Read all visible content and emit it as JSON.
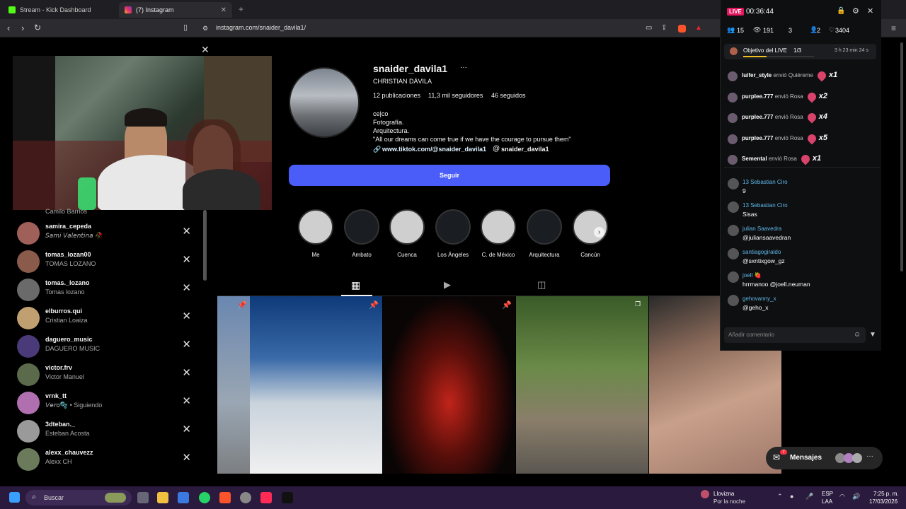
{
  "browser": {
    "tabs": [
      {
        "label": "Stream - Kick Dashboard"
      },
      {
        "label": "(7) Instagram"
      }
    ],
    "url": "instagram.com/snaider_davila1/"
  },
  "profile": {
    "username": "snaider_davila1",
    "more": "···",
    "full_name": "CHRISTIAN DÁVILA",
    "posts": "12 publicaciones",
    "followers": "11,3 mil seguidores",
    "following": "46 seguidos",
    "bio": [
      "ce|co",
      "Fotografía.",
      "Arquitectura.",
      "\"All our dreams can come true if we have the courage to pursue them\""
    ],
    "link": "www.tiktok.com/@snaider_davila1",
    "threads": "snaider_davila1",
    "follow_label": "Seguir"
  },
  "highlights": [
    {
      "label": "Me",
      "color": "#cfcfcf"
    },
    {
      "label": "Ambato",
      "color": "#1a1d22"
    },
    {
      "label": "Cuenca",
      "color": "#cfcfcf"
    },
    {
      "label": "Los Ángeles",
      "color": "#1a1d22"
    },
    {
      "label": "C. de México",
      "color": "#cfcfcf"
    },
    {
      "label": "Arquitectura",
      "color": "#1a1d22"
    },
    {
      "label": "Cancún",
      "color": "#cfcfcf"
    }
  ],
  "sidebar": {
    "top_partial": "Camilo Barrios",
    "items": [
      {
        "username": "samira_cepeda",
        "name": "𝘚𝘢𝘮𝘪 𝘝𝘢𝘭𝘦𝘯𝘵𝘪𝘯𝘢 🥀",
        "color": "#a0605a"
      },
      {
        "username": "tomas_lozan00",
        "name": "TOMAS LOZANO",
        "color": "#8a5a4a"
      },
      {
        "username": "tomas._lozano",
        "name": "Tomas lozano",
        "color": "#6a6a6a"
      },
      {
        "username": "elburros.qui",
        "name": "Cristian Loaiza",
        "color": "#c0a070"
      },
      {
        "username": "daguero_music",
        "name": "DAGUERO MUSIC",
        "color": "#4a3a7a"
      },
      {
        "username": "victor.frv",
        "name": "Victor Manuel",
        "color": "#5a6a4a"
      },
      {
        "username": "vrnk_tt",
        "name": "𝘝𝘦𝘳𝘰🫧 • Siguiendo",
        "color": "#b070b0"
      },
      {
        "username": "3dteban._",
        "name": "Esteban Acosta",
        "color": "#9a9a9a"
      },
      {
        "username": "alexx_chauvezz",
        "name": "Alexx CH",
        "color": "#6a7a5a"
      }
    ]
  },
  "live": {
    "badge": "LIVE",
    "timer": "00:36:44",
    "stats": {
      "viewers_icon": "15",
      "views": "191",
      "rank": "3",
      "users": "2",
      "likes": "3404"
    },
    "goal": "Objetivo del LIVE",
    "goal_progress": "1/3",
    "goal_time": "3 h 23 min 24 s",
    "gifts": [
      {
        "user": "luifer_style",
        "action": "envió Quiéreme",
        "count": "x1"
      },
      {
        "user": "purplee.777",
        "action": "envió Rosa",
        "count": "x2"
      },
      {
        "user": "purplee.777",
        "action": "envió Rosa",
        "count": "x4"
      },
      {
        "user": "purplee.777",
        "action": "envió Rosa",
        "count": "x5"
      },
      {
        "user": "Semental",
        "action": "envió Rosa",
        "count": "x1"
      }
    ],
    "chat": [
      {
        "user": "13  Sebastian Ciro",
        "msg": "9"
      },
      {
        "user": "13  Sebastian Ciro",
        "msg": "Sisas"
      },
      {
        "user": "julian Saavedra",
        "msg": "@juliansaavedran"
      },
      {
        "user": "santiagogiraldo",
        "msg": "@sxntixgow_gz"
      },
      {
        "user": "joell 🍓",
        "msg": "hrrmanoo @joell.neuman"
      },
      {
        "user": "gehovanny_x",
        "msg": "@geho_x"
      }
    ],
    "comment_placeholder": "Añadir comentario"
  },
  "messages": {
    "label": "Mensajes",
    "badge": "7"
  },
  "taskbar": {
    "search": "Buscar",
    "weather_title": "Llovizna",
    "weather_sub": "Por la noche",
    "lang1": "ESP",
    "lang2": "LAA",
    "time": "7:25 p. m.",
    "date": "17/03/2026"
  }
}
